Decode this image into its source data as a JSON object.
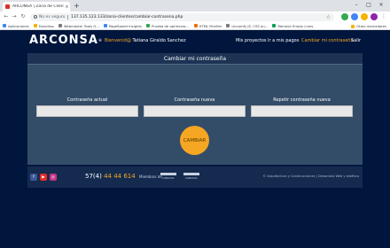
{
  "browser": {
    "tab": {
      "title": "ARCONSA | Zona de Clientes",
      "close_icon": "×"
    },
    "new_tab_icon": "+",
    "window_controls": [
      "–",
      "□",
      "×"
    ],
    "nav": {
      "back_icon": "←",
      "forward_icon": "→",
      "reload_icon": "↻"
    },
    "address": {
      "security_label": "No es seguro",
      "url": "137.135.123.133/zona-clientes/cambiar-contrasena.php",
      "star_icon": "☆"
    },
    "bookmarks": [
      {
        "label": "Aplicaciones",
        "color": "#4285f4"
      },
      {
        "label": "Favoritos",
        "color": "#f4b400"
      },
      {
        "label": "Webmaster Tools G...",
        "color": "#7b7b7b"
      },
      {
        "label": "PageSpeed Insights",
        "color": "#4285f4"
      },
      {
        "label": "Prueba de optimizac...",
        "color": "#34a853"
      },
      {
        "label": "HTML Minifier",
        "color": "#e8710a"
      },
      {
        "label": "Uncomfy JS, CSS an...",
        "color": "#7b7b7b"
      },
      {
        "label": "Remove Empty Lines",
        "color": "#0f9d58"
      }
    ],
    "other_bookmarks": "Otros marcadores"
  },
  "site": {
    "logo": "ARCONSA",
    "logo_mark": "®",
    "welcome_label": "Bienvenid@",
    "user_name": "Tatiana Giraldo Sanchez",
    "nav": [
      {
        "label": "Mis proyectos"
      },
      {
        "label": "Ir a mis pagos"
      },
      {
        "label": "Cambiar mi contraseña"
      },
      {
        "label": "Salir"
      }
    ],
    "form": {
      "title": "Cambiar mi contraseña",
      "fields": [
        {
          "label": "Contraseña actual",
          "value": ""
        },
        {
          "label": "Contraseña nueva",
          "value": ""
        },
        {
          "label": "Repetir contraseña nueva",
          "value": ""
        }
      ],
      "submit_label": "CAMBIAR"
    },
    "footer": {
      "social": [
        {
          "icon": "facebook-icon",
          "glyph": "f",
          "color": "#3b5998"
        },
        {
          "icon": "youtube-icon",
          "glyph": "▶",
          "color": "#e52d27"
        },
        {
          "icon": "instagram-icon",
          "glyph": "◎",
          "color": "#c13584"
        }
      ],
      "phone_prefix": "57(4)",
      "phone_number": "44 44 614",
      "members_label": "Miembros de",
      "member_logos": [
        "CAMACOL",
        "CAMACOL"
      ],
      "credits": "© Arquitectura y Construcciones | Desarrollo Web y estética"
    }
  }
}
